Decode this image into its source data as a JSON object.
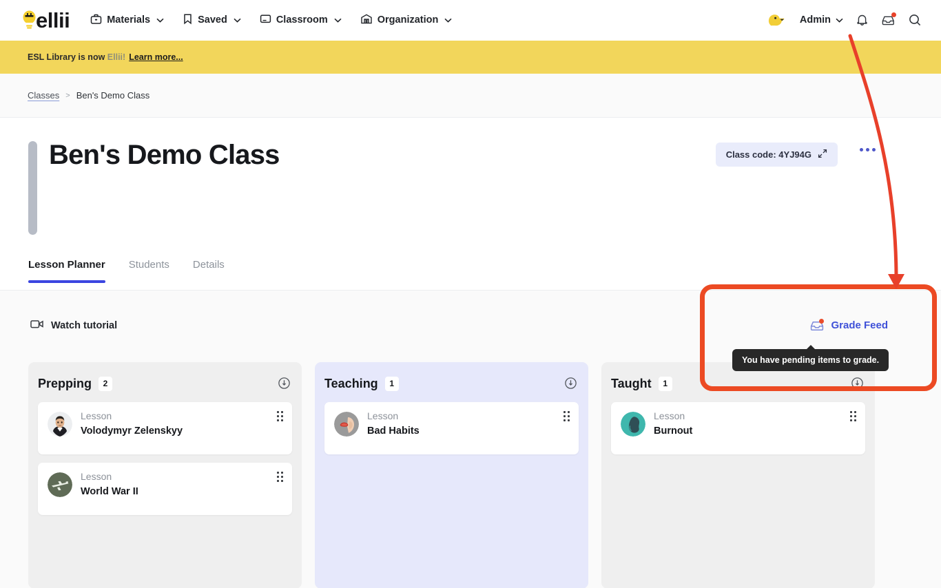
{
  "topnav": {
    "logo_text": "ellii",
    "logo_icon": "lightbulb-icon",
    "items": [
      {
        "label": "Materials",
        "icon": "briefcase-icon"
      },
      {
        "label": "Saved",
        "icon": "bookmark-icon"
      },
      {
        "label": "Classroom",
        "icon": "monitor-icon"
      },
      {
        "label": "Organization",
        "icon": "building-icon"
      }
    ],
    "account_label": "Admin",
    "avatar_icon": "duck-avatar-icon",
    "bell_icon": "bell-icon",
    "inbox_icon": "inbox-icon",
    "search_icon": "search-icon",
    "inbox_has_badge": true
  },
  "banner": {
    "text_before": "ESL Library is now ",
    "brand": "Ellii!",
    "link": "Learn more..."
  },
  "breadcrumb": {
    "root": "Classes",
    "separator": ">",
    "current": "Ben's Demo Class"
  },
  "hero": {
    "title": "Ben's Demo Class",
    "class_code_label": "Class code: 4YJ94G",
    "class_code_icon": "expand-arrows-icon",
    "more_menu_icon": "kebab-menu-icon",
    "accent_color": "#3b45e0"
  },
  "tabs": [
    {
      "label": "Lesson Planner",
      "active": true
    },
    {
      "label": "Students",
      "active": false
    },
    {
      "label": "Details",
      "active": false
    }
  ],
  "planner": {
    "watch_tutorial": "Watch tutorial",
    "watch_icon": "video-camera-icon",
    "grade_feed": "Grade Feed",
    "grade_feed_icon": "inbox-icon",
    "grade_feed_color": "#3f51d8",
    "tooltip": "You have pending items to grade."
  },
  "columns": [
    {
      "title": "Prepping",
      "count": "2",
      "theme": "grey",
      "info_icon": "info-circle-icon",
      "cards": [
        {
          "type": "Lesson",
          "title": "Volodymyr Zelenskyy",
          "thumb": "portrait-zelenskyy",
          "drag_icon": "drag-handle-icon"
        },
        {
          "type": "Lesson",
          "title": "World War II",
          "thumb": "airplane-green",
          "drag_icon": "drag-handle-icon"
        }
      ]
    },
    {
      "title": "Teaching",
      "count": "1",
      "theme": "blue",
      "info_icon": "info-circle-icon",
      "cards": [
        {
          "type": "Lesson",
          "title": "Bad Habits",
          "thumb": "nail-biting-grey",
          "drag_icon": "drag-handle-icon"
        }
      ]
    },
    {
      "title": "Taught",
      "count": "1",
      "theme": "grey",
      "info_icon": "info-circle-icon",
      "cards": [
        {
          "type": "Lesson",
          "title": "Burnout",
          "thumb": "head-silhouette-teal",
          "drag_icon": "drag-handle-icon"
        }
      ]
    }
  ],
  "annotation": {
    "highlight_color": "#ec4a23",
    "shape": "rounded-rectangle-with-arrow"
  }
}
